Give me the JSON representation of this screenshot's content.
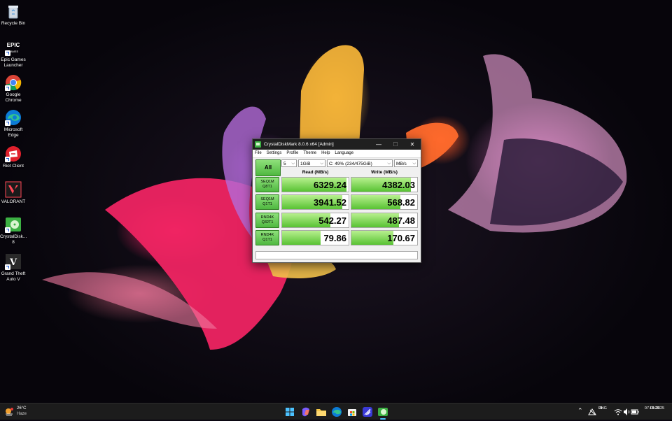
{
  "desktop": {
    "icons": [
      {
        "label": "Recycle Bin",
        "icon": "recycle-bin-icon"
      },
      {
        "label": "Epic Games Launcher",
        "icon": "epic-games-icon"
      },
      {
        "label": "Google Chrome",
        "icon": "chrome-icon"
      },
      {
        "label": "Microsoft Edge",
        "icon": "edge-icon"
      },
      {
        "label": "Riot Client",
        "icon": "riot-client-icon"
      },
      {
        "label": "VALORANT",
        "icon": "valorant-icon"
      },
      {
        "label": "CrystalDisk... 8",
        "icon": "crystaldiskmark-icon"
      },
      {
        "label": "Grand Theft Auto V",
        "icon": "gta-v-icon"
      }
    ]
  },
  "window": {
    "title": "CrystalDiskMark 8.0.6 x64 [Admin]",
    "controls": {
      "minimize": "—",
      "maximize": "☐",
      "close": "✕"
    },
    "menu": [
      "File",
      "Settings",
      "Profile",
      "Theme",
      "Help",
      "Language"
    ],
    "all_button": "All",
    "count": "5",
    "size": "1GiB",
    "drive": "C: 49% (234/475GiB)",
    "unit": "MB/s",
    "read_header": "Read (MB/s)",
    "write_header": "Write (MB/s)",
    "rows": [
      {
        "line1": "SEQ1M",
        "line2": "Q8T1",
        "read": "6329.24",
        "write": "4382.03",
        "read_fill": 0.97,
        "write_fill": 0.9
      },
      {
        "line1": "SEQ1M",
        "line2": "Q1T1",
        "read": "3941.52",
        "write": "568.82",
        "read_fill": 0.91,
        "write_fill": 0.74
      },
      {
        "line1": "RND4K",
        "line2": "Q32T1",
        "read": "542.27",
        "write": "487.48",
        "read_fill": 0.73,
        "write_fill": 0.72
      },
      {
        "line1": "RND4K",
        "line2": "Q1T1",
        "read": "79.86",
        "write": "170.67",
        "read_fill": 0.58,
        "write_fill": 0.64
      }
    ],
    "comment": ""
  },
  "taskbar": {
    "weather": {
      "temp": "26°C",
      "condition": "Haze"
    },
    "apps": [
      "windows-start-icon",
      "copilot-icon",
      "file-explorer-icon",
      "edge-icon",
      "microsoft-store-icon",
      "linear-icon",
      "crystaldiskmark-icon"
    ],
    "language": {
      "line1": "ENG",
      "line2": "IN"
    },
    "time": "13:26",
    "date": "07-05-2025"
  },
  "colors": {
    "accent_green": "#4fb840",
    "taskbar": "#1c1c1c",
    "titlebar": "#202020"
  }
}
